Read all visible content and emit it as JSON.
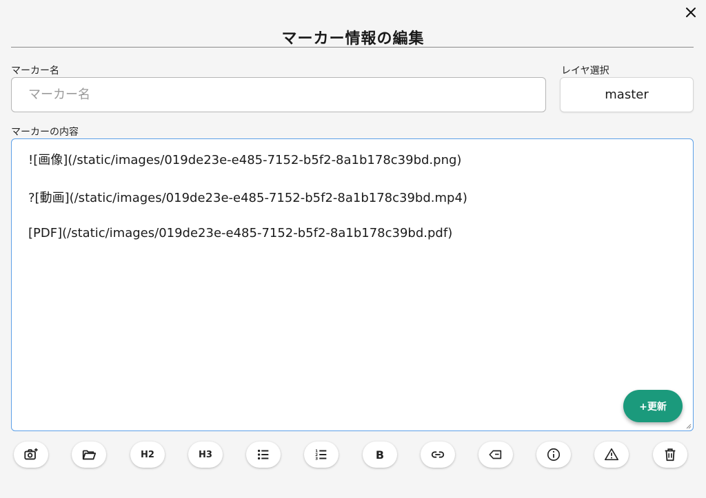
{
  "dialog": {
    "title": "マーカー情報の編集",
    "close_icon": "close-icon"
  },
  "marker_name": {
    "label": "マーカー名",
    "value": "",
    "placeholder": "マーカー名"
  },
  "layer": {
    "label": "レイヤ選択",
    "selected": "master"
  },
  "content": {
    "label": "マーカーの内容",
    "lines": [
      "![画像](/static/images/019de23e-e485-7152-b5f2-8a1b178c39bd.png)",
      "?[動画](/static/images/019de23e-e485-7152-b5f2-8a1b178c39bd.mp4)",
      "[PDF](/static/images/019de23e-e485-7152-b5f2-8a1b178c39bd.pdf)"
    ]
  },
  "update_button": {
    "label": "+更新",
    "color": "#1b9a7c"
  },
  "toolbar": {
    "h2_label": "H2",
    "h3_label": "H3",
    "bold_label": "B",
    "icons": [
      "camera-plus-icon",
      "folder-open-icon",
      "heading-2-icon",
      "heading-3-icon",
      "bullet-list-icon",
      "numbered-list-icon",
      "bold-icon",
      "link-icon",
      "tag-icon",
      "info-icon",
      "warning-icon",
      "trash-icon"
    ]
  },
  "colors": {
    "accent": "#1b9a7c",
    "focus_border": "#5b9fe8"
  }
}
